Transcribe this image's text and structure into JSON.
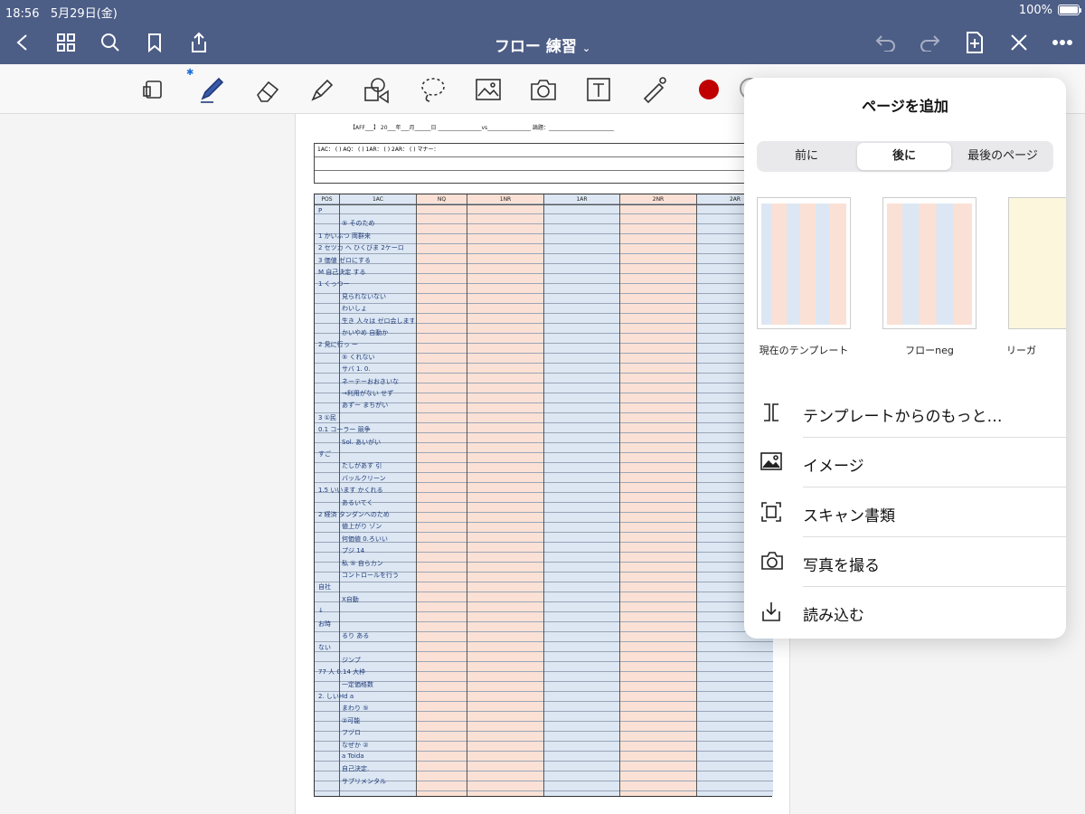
{
  "status": {
    "time": "18:56",
    "date": "5月29日(金)",
    "battery": "100%"
  },
  "header": {
    "title": "フロー 練習"
  },
  "page": {
    "header_line": "【AFF___】 20___年___月______日 ________________vs________________ 論題：________________________",
    "info_row": "1AC：                 (      )  AQ：                    (      )  1AR：                  (      )  2AR：                   (      )  マナー：",
    "columns": [
      "POS",
      "1AC",
      "NQ",
      "1NR",
      "1AR",
      "2NR",
      "2AR"
    ],
    "handwriting": [
      "P",
      "⑤ そのため",
      "1 かいぶつ 両群来",
      "2 セツカ へ ひくびま 2ケーロ",
      "3 価値 ゼロにする",
      "M 自己決定 する",
      "1 くっつー",
      "見られないない",
      "わいしょ",
      "生き 人々は ゼロ会します",
      "かいやめ 自動か",
      "2 見に行っ ー",
      "⑤ くれない",
      "サバ 1. 0.",
      "ネーテーおおきいな",
      "→利用がない せず",
      "あずー まちがい",
      "3 ①民",
      "0.1 コーラー 競争",
      "Sol. あいがい",
      "すご",
      "たしがあす 引",
      "バッルクリーン",
      "1.5 いいます かくれる",
      "あるいてく",
      "2 経済 タンダンへのため",
      "値上がり ゾン",
      "何価値 0.ろいい",
      "プジ 14",
      "私 ⑤ 自らカン",
      "コントロールを行う",
      "自社",
      "X自動",
      "↓",
      "お時",
      "るり ある",
      "ない",
      "ジンプ",
      "77 人 0.14 大枠",
      "一定価格数",
      "2. しいHd a",
      "まわり ⑤",
      "②可能",
      "フヅロ",
      "なぜか ②",
      "a Toida",
      "自己決定.",
      "サプリメンタル"
    ]
  },
  "panel": {
    "title": "ページを追加",
    "segments": [
      "前に",
      "後に",
      "最後のページ"
    ],
    "selected_segment": "後に",
    "templates": [
      "現在のテンプレート",
      "フローneg",
      "リーガ"
    ],
    "menu": [
      {
        "label": "テンプレートからのもっと…",
        "icon": "template-icon"
      },
      {
        "label": "イメージ",
        "icon": "image-icon"
      },
      {
        "label": "スキャン書類",
        "icon": "scan-icon"
      },
      {
        "label": "写真を撮る",
        "icon": "camera-icon"
      },
      {
        "label": "読み込む",
        "icon": "import-icon"
      }
    ]
  },
  "colors": {
    "nav": "#4c5d86",
    "blue_col": "#dce7f3",
    "peach_col": "#fbe1d5",
    "red_swatch": "#c00000"
  }
}
